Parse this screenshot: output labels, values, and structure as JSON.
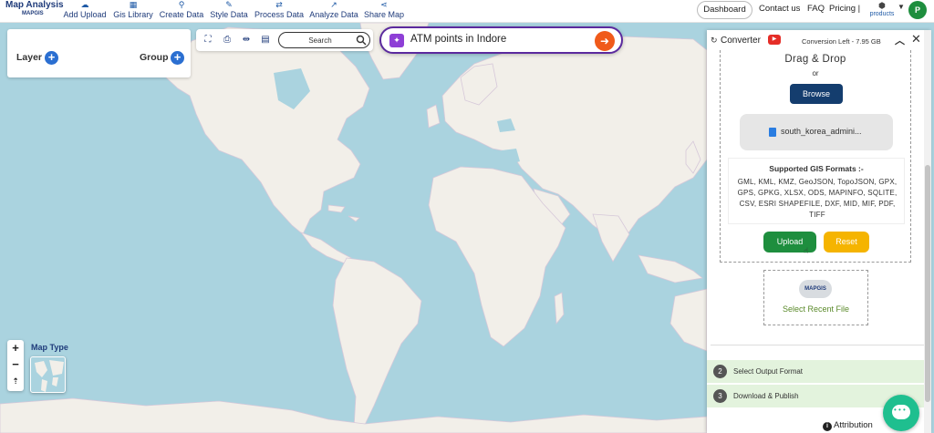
{
  "brand": {
    "title": "Map Analysis",
    "subtitle": "MAPGIS"
  },
  "nav": [
    {
      "label": "Add Upload",
      "icon": "cloud-upload-icon",
      "glyph": "☁"
    },
    {
      "label": "Gis Library",
      "icon": "library-icon",
      "glyph": "▦"
    },
    {
      "label": "Create Data",
      "icon": "map-pin-icon",
      "glyph": "⚲"
    },
    {
      "label": "Style Data",
      "icon": "style-icon",
      "glyph": "✎"
    },
    {
      "label": "Process Data",
      "icon": "process-icon",
      "glyph": "⇄"
    },
    {
      "label": "Analyze Data",
      "icon": "analyze-icon",
      "glyph": "↗"
    },
    {
      "label": "Share Map",
      "icon": "share-icon",
      "glyph": "⋖"
    }
  ],
  "header_right": {
    "dashboard": "Dashboard",
    "contact": "Contact us",
    "faq": "FAQ",
    "pricing": "Pricing |",
    "products": "products",
    "avatar_initial": "P"
  },
  "layer_panel": {
    "layer_label": "Layer",
    "group_label": "Group"
  },
  "search": {
    "placeholder": "Search"
  },
  "ai_prompt": {
    "text": "ATM points in Indore"
  },
  "map_type": {
    "label": "Map Type"
  },
  "converter": {
    "title": "Converter",
    "conversion_left": "Conversion Left - 7.95 GB",
    "drag_drop": "Drag & Drop",
    "or": "or",
    "browse": "Browse",
    "file_name": "south_korea_admini...",
    "formats_title": "Supported GIS Formats :-",
    "formats_list": "GML, KML, KMZ, GeoJSON, TopoJSON, GPX, GPS, GPKG, XLSX, ODS, MAPINFO, SQLITE, CSV, ESRI SHAPEFILE, DXF, MID, MIF, PDF, TIFF",
    "upload": "Upload",
    "reset": "Reset",
    "recent_logo": "MAPGIS",
    "recent_label": "Select Recent File",
    "steps": [
      {
        "num": "2",
        "label": "Select Output Format"
      },
      {
        "num": "3",
        "label": "Download & Publish"
      }
    ]
  },
  "attribution": "Attribution",
  "colors": {
    "accent": "#2b6fd1",
    "brand": "#1f3b7a",
    "upload": "#1e8e3e",
    "reset": "#f5b400",
    "ai_border": "#5b2a9e",
    "go": "#f05a1a",
    "water": "#aad3df",
    "land": "#f2efe9"
  }
}
